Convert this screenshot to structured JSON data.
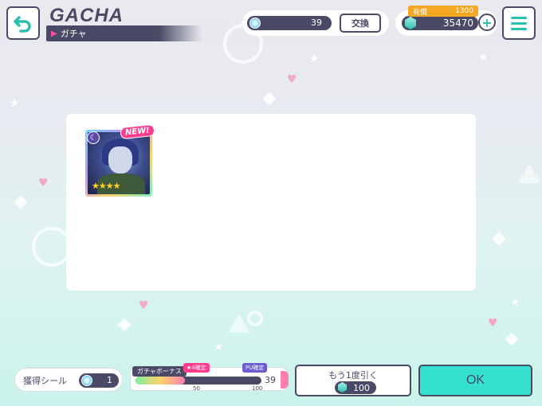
{
  "header": {
    "title_en": "GACHA",
    "title_jp": "ガチャ"
  },
  "currency": {
    "stones": "39",
    "exchange_label": "交換",
    "paid_label": "有償",
    "paid_value": "1300",
    "gems": "35470"
  },
  "result": {
    "card": {
      "new_label": "NEW!",
      "stars": 4,
      "stars_text": "★★★★"
    }
  },
  "footer": {
    "seal_label": "獲得シール",
    "seal_count": "1",
    "bonus_title": "ガチャボーナス",
    "bonus_tag1": "★4確定",
    "bonus_tag2": "PU確定",
    "bonus_tick1": "50",
    "bonus_tick2": "100",
    "bonus_value": "39",
    "bonus_progress": 0.39,
    "again_label": "もう1度引く",
    "again_cost": "100",
    "ok_label": "OK"
  },
  "colors": {
    "frame": "#4a4a66",
    "accent": "#34e0d0",
    "pink": "#ff3f8e"
  }
}
